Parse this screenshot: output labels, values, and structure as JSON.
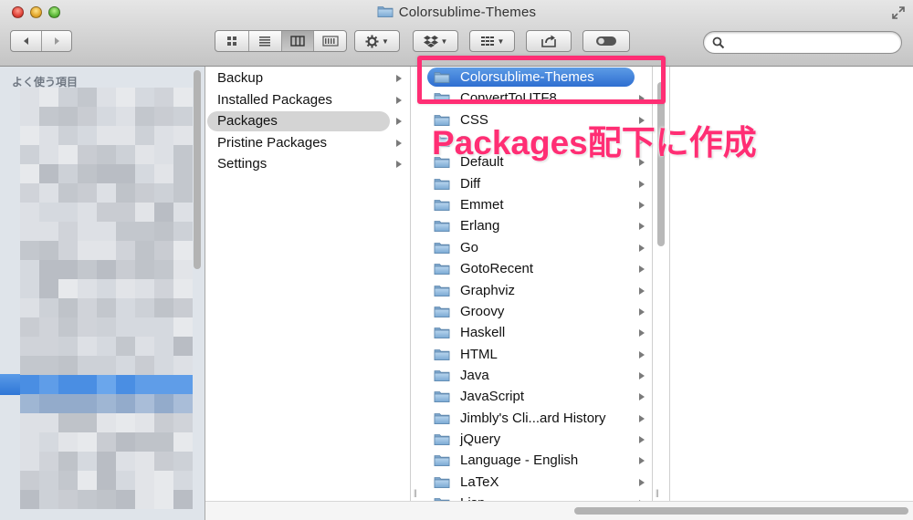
{
  "window": {
    "title": "Colorsublime-Themes"
  },
  "toolbar": {
    "nav_back_icon": "chevron-left-icon",
    "nav_forward_icon": "chevron-right-icon",
    "view_modes": [
      "icon-view-icon",
      "list-view-icon",
      "column-view-icon",
      "coverflow-view-icon"
    ],
    "active_view": "column-view-icon",
    "action_icon": "gear-icon",
    "dropbox_icon": "dropbox-icon",
    "arrange_icon": "arrange-grid-icon",
    "share_icon": "share-icon",
    "toggle_icon": "toggle-icon",
    "search_placeholder": ""
  },
  "sidebar": {
    "heading": "よく使う項目"
  },
  "column1": {
    "items": [
      {
        "label": "Backup"
      },
      {
        "label": "Installed Packages"
      },
      {
        "label": "Packages",
        "selected": true
      },
      {
        "label": "Pristine Packages"
      },
      {
        "label": "Settings"
      }
    ]
  },
  "column2": {
    "items": [
      {
        "label": "Colorsublime-Themes",
        "selected": true
      },
      {
        "label": "ConvertToUTF8"
      },
      {
        "label": "CSS"
      },
      {
        "label": "D"
      },
      {
        "label": "Default"
      },
      {
        "label": "Diff"
      },
      {
        "label": "Emmet"
      },
      {
        "label": "Erlang"
      },
      {
        "label": "Go"
      },
      {
        "label": "GotoRecent"
      },
      {
        "label": "Graphviz"
      },
      {
        "label": "Groovy"
      },
      {
        "label": "Haskell"
      },
      {
        "label": "HTML"
      },
      {
        "label": "Java"
      },
      {
        "label": "JavaScript"
      },
      {
        "label": "Jimbly's Cli...ard History"
      },
      {
        "label": "jQuery"
      },
      {
        "label": "Language - English"
      },
      {
        "label": "LaTeX"
      },
      {
        "label": "Lisp"
      }
    ]
  },
  "annotation": {
    "text": "Packages配下に作成",
    "color": "#ff2e74"
  },
  "colors": {
    "selection_blue": "#3b7fdc",
    "sidebar_bg": "#dfe4ea",
    "folder_blue": "#8fb8dc"
  }
}
